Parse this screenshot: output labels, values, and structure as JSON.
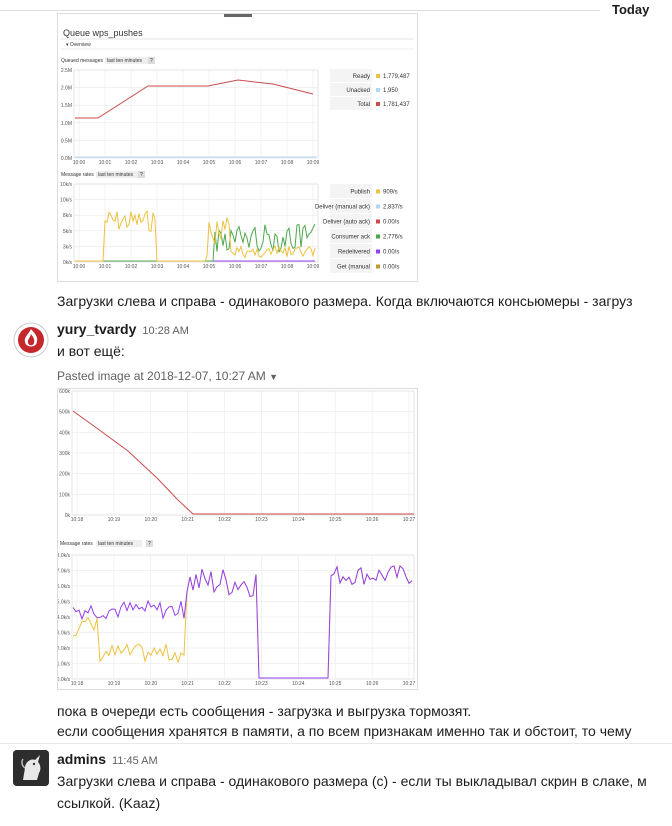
{
  "day_divider": "Today",
  "messages": [
    {
      "text": "Загрузки слева и справа - одинакового размера. Когда включаются консьюмеры - загруз"
    },
    {
      "author": "yury_tvardy",
      "time": "10:28 AM",
      "text": "и вот ещё:",
      "pasted_label": "Pasted image at 2018-12-07, 10:27 AM",
      "after_lines": [
        "пока в очереди есть сообщения - загрузка и выгрузка тормозят.",
        "если сообщения хранятся в памяти, а по всем признакам именно так и обстоит, то чему"
      ]
    },
    {
      "author": "admins",
      "time": "11:45 AM",
      "lines": [
        "Загрузки слева и справа - одинакового размера (с) - если ты выкладывал скрин в слаке, м",
        "ссылкой. (Kaaz)"
      ]
    }
  ],
  "shot1": {
    "title_prefix": "Queue ",
    "title_name": "wps_pushes",
    "overview": "Overview",
    "queued_label": "Queued messages",
    "rates_label": "Message rates",
    "range": "last ten minutes",
    "help": "?",
    "y_ticks_top": [
      "2.5M",
      "2.0M",
      "1.5M",
      "1.0M",
      "0.5M",
      "0.0M"
    ],
    "x_ticks": [
      "10:00",
      "10:01",
      "10:02",
      "10:03",
      "10:04",
      "10:05",
      "10:06",
      "10:07",
      "10:08",
      "10:09"
    ],
    "y_ticks_rates": [
      "10k/s",
      "10k/s",
      "8k/s",
      "5k/s",
      "3k/s",
      "0k/s"
    ],
    "x_ticks_rates": [
      "10:00",
      "10:01",
      "10:02",
      "10:03",
      "10:04",
      "10:05",
      "10:06",
      "10:07",
      "10:08",
      "10:09"
    ],
    "legend_top": [
      {
        "label": "Ready",
        "value": "1,779,487",
        "color": "#edc240"
      },
      {
        "label": "Unacked",
        "value": "1,950",
        "color": "#afd8f8"
      },
      {
        "label": "Total",
        "value": "1,781,437",
        "color": "#cb4b4b"
      }
    ],
    "legend_rates": [
      {
        "label": "Publish",
        "value": "909/s",
        "color": "#edc240"
      },
      {
        "label": "Deliver (manual ack)",
        "value": "2,837/s",
        "color": "#afd8f8"
      },
      {
        "label": "Deliver (auto ack)",
        "value": "0.00/s",
        "color": "#cb4b4b"
      },
      {
        "label": "Consumer ack",
        "value": "2,776/s",
        "color": "#4da74d"
      },
      {
        "label": "Redelivered",
        "value": "0.00/s",
        "color": "#9440ed"
      },
      {
        "label": "Get (manual",
        "value": "0.00/s",
        "color": "#bd9b33"
      }
    ]
  },
  "shot2": {
    "y_ticks_top": [
      "600k",
      "500k",
      "400k",
      "300k",
      "200k",
      "100k",
      "0k"
    ],
    "x_ticks": [
      "10:18",
      "10:19",
      "10:20",
      "10:21",
      "10:22",
      "10:23",
      "10:24",
      "10:25",
      "10:26",
      "10:27"
    ],
    "rates_label": "Message rates",
    "range": "last ten minutes",
    "help": "?",
    "y_ticks_rates": [
      "8.0k/s",
      "7.0k/s",
      "6.0k/s",
      "5.0k/s",
      "4.0k/s",
      "3.0k/s",
      "2.0k/s",
      "1.0k/s",
      "0.0k/s"
    ],
    "x_ticks_rates": [
      "10:18",
      "10:19",
      "10:20",
      "10:21",
      "10:22",
      "10:23",
      "10:24",
      "10:25",
      "10:26",
      "10:27"
    ]
  },
  "colors": {
    "red": "#cb4b4b",
    "yellow": "#edc240",
    "green": "#4da74d",
    "purple": "#9440ed",
    "grid": "#e6e6e6"
  }
}
